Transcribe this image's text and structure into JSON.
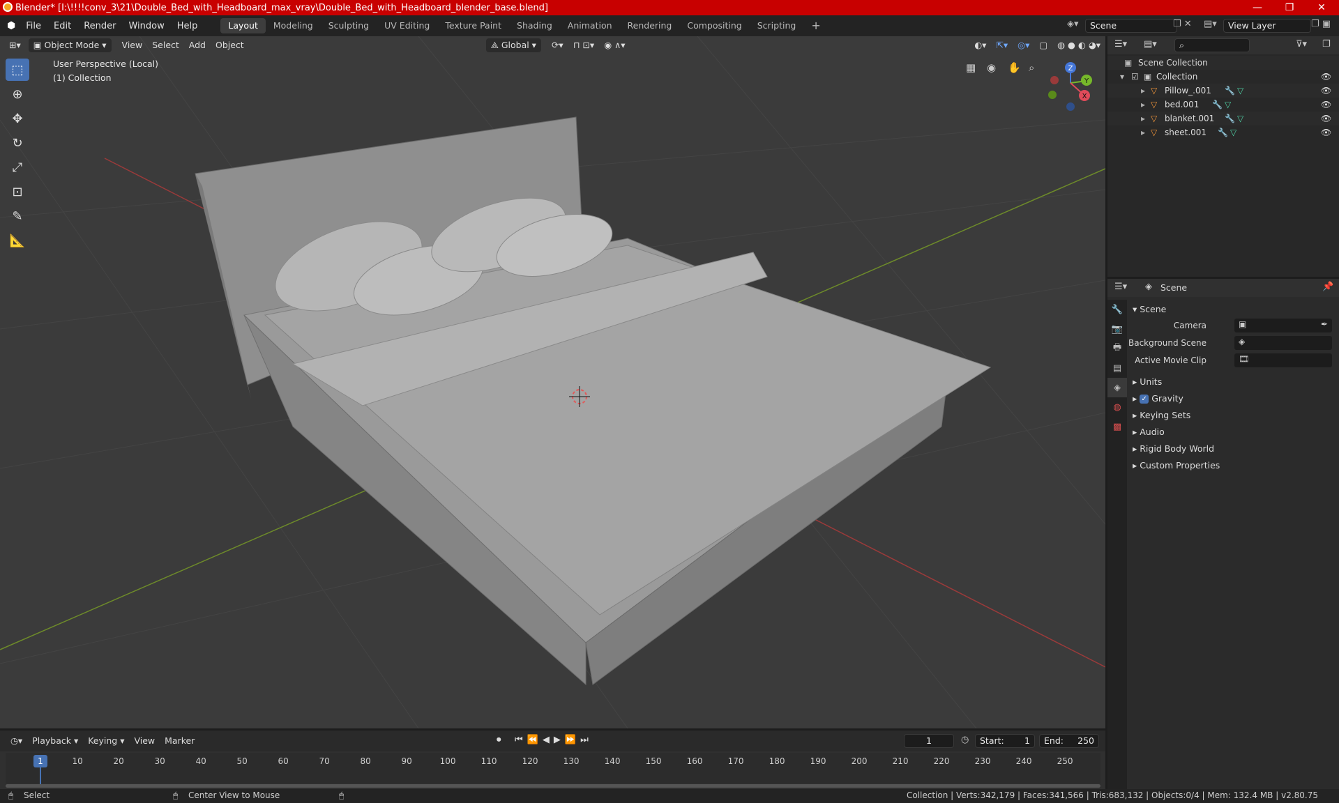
{
  "window": {
    "title": "Blender* [I:\\!!!!conv_3\\21\\Double_Bed_with_Headboard_max_vray\\Double_Bed_with_Headboard_blender_base.blend]",
    "minimize": "—",
    "maximize": "❐",
    "close": "✕"
  },
  "menubar": [
    "File",
    "Edit",
    "Render",
    "Window",
    "Help"
  ],
  "workspaces": [
    "Layout",
    "Modeling",
    "Sculpting",
    "UV Editing",
    "Texture Paint",
    "Shading",
    "Animation",
    "Rendering",
    "Compositing",
    "Scripting"
  ],
  "scene_field": "Scene",
  "view_layer_field": "View Layer",
  "viewport": {
    "mode": "Object Mode",
    "menus": [
      "View",
      "Select",
      "Add",
      "Object"
    ],
    "transform": "Global",
    "overlay_line1": "User Perspective (Local)",
    "overlay_line2": "(1) Collection",
    "gizmo": {
      "z": "Z",
      "y": "Y",
      "x": "X"
    }
  },
  "outliner": {
    "root": "Scene Collection",
    "collection": "Collection",
    "objects": [
      "Pillow_.001",
      "bed.001",
      "blanket.001",
      "sheet.001"
    ]
  },
  "properties": {
    "context": "Scene",
    "panel": "Scene",
    "camera_label": "Camera",
    "background_scene_label": "Background Scene",
    "active_movie_clip_label": "Active Movie Clip",
    "sections": [
      "Units",
      "Gravity",
      "Keying Sets",
      "Audio",
      "Rigid Body World",
      "Custom Properties"
    ],
    "gravity_checked": true
  },
  "timeline": {
    "menus": [
      "Playback",
      "Keying",
      "View",
      "Marker"
    ],
    "current_frame": "1",
    "start_label": "Start:",
    "start": "1",
    "end_label": "End:",
    "end": "250",
    "ticks": [
      "1",
      "10",
      "20",
      "30",
      "40",
      "50",
      "60",
      "70",
      "80",
      "90",
      "100",
      "110",
      "120",
      "130",
      "140",
      "150",
      "160",
      "170",
      "180",
      "190",
      "200",
      "210",
      "220",
      "230",
      "240",
      "250"
    ]
  },
  "status": {
    "select": "Select",
    "center": "Center View to Mouse",
    "stats": "Collection | Verts:342,179 | Faces:341,566 | Tris:683,132 | Objects:0/4 | Mem: 132.4 MB | v2.80.75"
  }
}
